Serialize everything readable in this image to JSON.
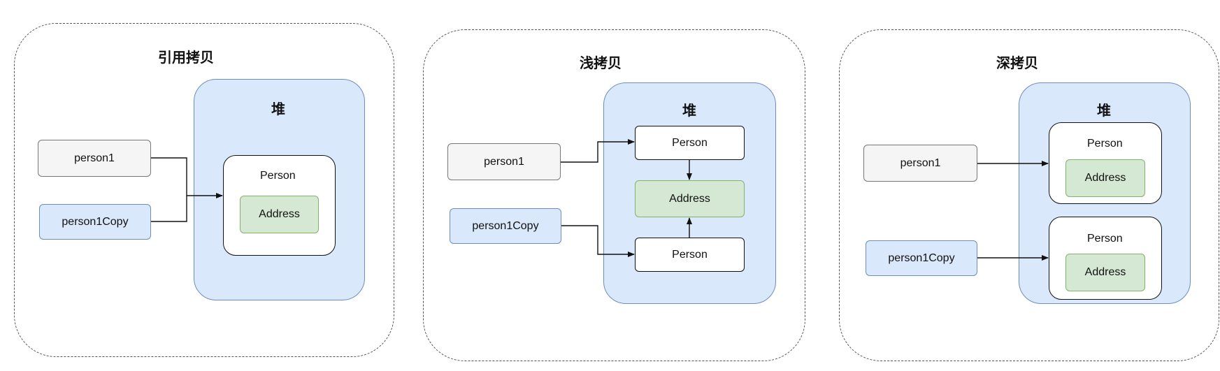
{
  "panels": [
    {
      "title": "引用拷贝",
      "heap_label": "堆",
      "var1": "person1",
      "var2": "person1Copy",
      "object": "Person",
      "address": "Address"
    },
    {
      "title": "浅拷贝",
      "heap_label": "堆",
      "var1": "person1",
      "var2": "person1Copy",
      "object_top": "Person",
      "address": "Address",
      "object_bottom": "Person"
    },
    {
      "title": "深拷贝",
      "heap_label": "堆",
      "var1": "person1",
      "var2": "person1Copy",
      "object_top": "Person",
      "address_top": "Address",
      "object_bottom": "Person",
      "address_bottom": "Address"
    }
  ],
  "colors": {
    "heap_fill": "#dae8fc",
    "heap_stroke": "#6c8ebf",
    "address_fill": "#d5e8d4",
    "address_stroke": "#82b366",
    "var_grey_fill": "#f5f5f5"
  }
}
